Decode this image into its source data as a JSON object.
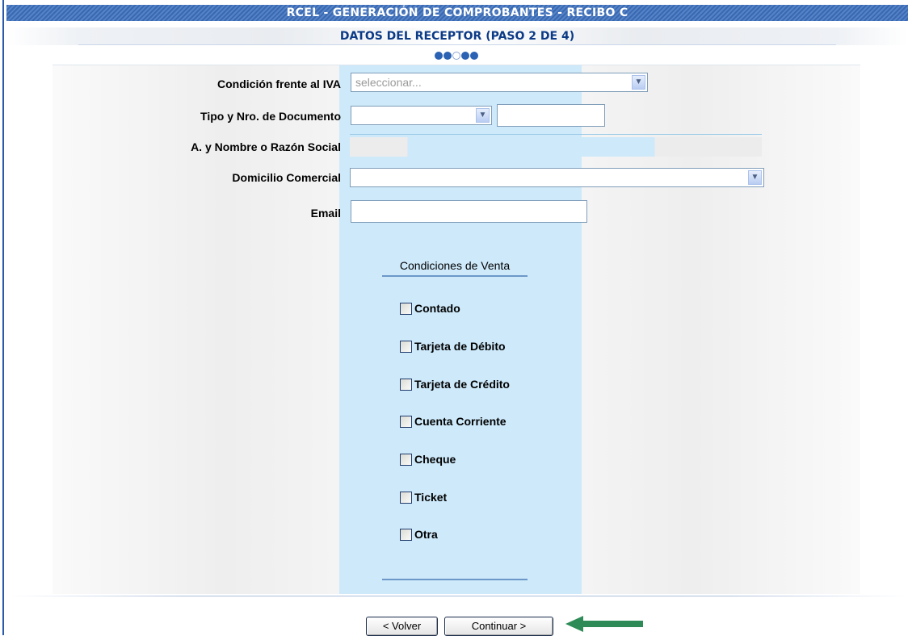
{
  "header": {
    "title": "RCEL - GENERACIÓN DE COMPROBANTES - RECIBO C",
    "subtitle": "DATOS DEL RECEPTOR (PASO 2 DE 4)",
    "step_current": 2,
    "step_total": 4
  },
  "form": {
    "condicion_iva": {
      "label": "Condición frente al IVA",
      "placeholder": "seleccionar..."
    },
    "documento": {
      "label": "Tipo y Nro. de Documento",
      "tipo_value": "",
      "numero_value": ""
    },
    "razon_social": {
      "label": "A. y Nombre o Razón Social",
      "value": ""
    },
    "domicilio": {
      "label": "Domicilio Comercial",
      "value": ""
    },
    "email": {
      "label": "Email",
      "value": ""
    }
  },
  "condiciones_venta": {
    "title": "Condiciones de Venta",
    "options": [
      {
        "label": "Contado",
        "checked": false
      },
      {
        "label": "Tarjeta de Débito",
        "checked": false
      },
      {
        "label": "Tarjeta de Crédito",
        "checked": false
      },
      {
        "label": "Cuenta Corriente",
        "checked": false
      },
      {
        "label": "Cheque",
        "checked": false
      },
      {
        "label": "Ticket",
        "checked": false
      },
      {
        "label": "Otra",
        "checked": false
      }
    ]
  },
  "buttons": {
    "volver": "< Volver",
    "continuar": "Continuar >"
  },
  "colors": {
    "header_bar": "#3b69b1",
    "center_panel": "#cde9fa",
    "annotation_arrow": "#2e8b57"
  },
  "icons": {
    "step_indicator": "step-dots-icon",
    "dropdown": "chevron-down-icon",
    "pointer": "arrow-left-icon"
  }
}
